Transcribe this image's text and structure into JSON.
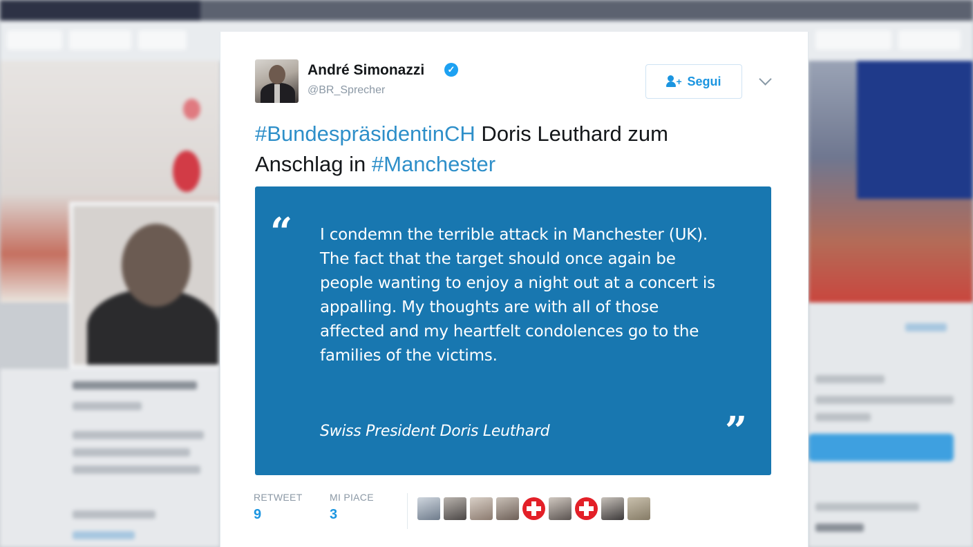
{
  "tweet": {
    "author_name": "André Simonazzi",
    "author_handle": "@BR_Sprecher",
    "follow_label": "Segui",
    "text_parts": [
      "#BundespräsidentinCH",
      " Doris Leuthard zum Anschlag in ",
      "#Manchester"
    ],
    "quote": {
      "open_mark": "“",
      "text": "I condemn the terrible attack in Manchester (UK). The fact that the target should once again be people wanting to enjoy a night out at a concert is appalling. My thoughts are with all of those affected and my heartfelt condolences go to the families of the victims.",
      "author": "Swiss President Doris Leuthard",
      "close_mark": "”",
      "background_color": "#1877b0"
    },
    "stats": {
      "retweet_label": "RETWEET",
      "retweet_count": "9",
      "like_label": "MI PIACE",
      "like_count": "3"
    },
    "likers": [
      "avatar-photo",
      "avatar-photo",
      "avatar-photo",
      "avatar-photo",
      "swiss-flag",
      "avatar-photo",
      "swiss-flag",
      "avatar-photo",
      "avatar-photo"
    ]
  },
  "colors": {
    "link": "#2e8fc9",
    "accent": "#1b95e0",
    "verified": "#1da1f2"
  }
}
